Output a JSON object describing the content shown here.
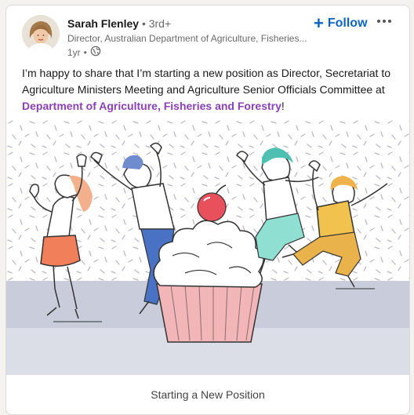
{
  "author": {
    "name": "Sarah Flenley",
    "degree": "• 3rd+",
    "headline": "Director, Australian Department of Agriculture, Fisheries...",
    "time": "1yr",
    "separator": "•",
    "visibility_icon": "globe-icon"
  },
  "actions": {
    "follow_plus": "+",
    "follow_label": "Follow",
    "more_icon": "more-options-icon"
  },
  "post": {
    "text_before": "I’m happy to share that I’m starting a new position as Director, Secretariat to Agriculture Ministers Meeting and Agriculture Senior Officials Committee at ",
    "company": "Department of Agriculture, Fisheries and Forestry",
    "text_after": "!"
  },
  "media": {
    "caption": "Starting a New Position"
  },
  "colors": {
    "accent": "#0a66c2",
    "company_link": "#8b41b4",
    "illustration_floor": "#c9cddb",
    "cherry": "#e8505b",
    "cupcake_liner": "#f2b6b8"
  }
}
